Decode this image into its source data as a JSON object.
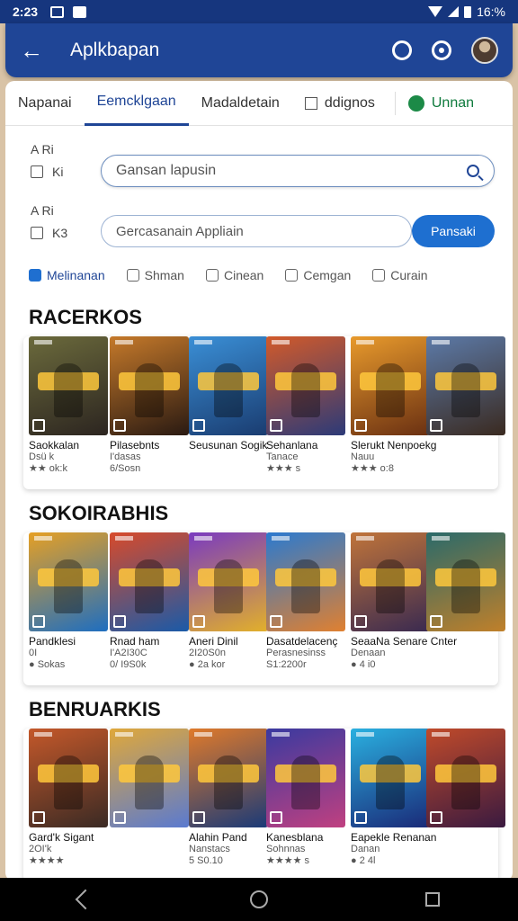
{
  "status": {
    "time": "2:23",
    "battery": "16:%"
  },
  "appbar": {
    "title": "Aplkbapan"
  },
  "tabs": [
    {
      "label": "Napanai"
    },
    {
      "label": "Eemcklgaan"
    },
    {
      "label": "Madaldetain"
    },
    {
      "label": "ddignos"
    },
    {
      "label": "Unnan"
    }
  ],
  "filters": {
    "label1": "A Ri",
    "check1": "Ki",
    "label2": "A Ri",
    "check2": "K3",
    "search_placeholder": "Gansan lapusin",
    "input_placeholder": "Gercasanain Appliain",
    "button": "Pansaki"
  },
  "chips": [
    "Melinanan",
    "Shman",
    "Cinean",
    "Cemgan",
    "Curain"
  ],
  "sections": [
    {
      "title": "RACERKOS",
      "games": [
        {
          "name": "Saokkalan",
          "sub": "Dsü k",
          "meta": "★★ ok:k",
          "colors": [
            "#6b6a3c",
            "#2c2520"
          ]
        },
        {
          "name": "Pilasebnts",
          "sub": "I'dasas",
          "meta": "6/Sosn",
          "colors": [
            "#c5792a",
            "#2a1a12"
          ]
        },
        {
          "name": "Seusunan Sogik",
          "sub": "",
          "meta": "",
          "colors": [
            "#3a8fd6",
            "#1a3c70"
          ]
        },
        {
          "name": "Sehanlana",
          "sub": "Tanace",
          "meta": "★★★ s",
          "colors": [
            "#d25a2a",
            "#2c3a78"
          ]
        },
        {
          "name": "Slerukt Nenpoekg",
          "sub": "Nauu",
          "meta": "★★★ o:8",
          "colors": [
            "#e89a2c",
            "#6a3012"
          ]
        },
        {
          "name": "",
          "sub": "",
          "meta": "",
          "colors": [
            "#5c7aa8",
            "#3a2a20"
          ]
        }
      ]
    },
    {
      "title": "SOKOIRABHIS",
      "games": [
        {
          "name": "Pandklesi",
          "sub": "0I",
          "meta": "● Sokas",
          "colors": [
            "#e6a024",
            "#1e6ec0"
          ]
        },
        {
          "name": "Rnad ham",
          "sub": "I'A2I30C",
          "meta": "0/ I9S0k",
          "colors": [
            "#d84a2a",
            "#1a5aa8"
          ]
        },
        {
          "name": "Aneri Dinil",
          "sub": "2I20S0n",
          "meta": "● 2a kor",
          "colors": [
            "#7a3ac0",
            "#e2b02a"
          ]
        },
        {
          "name": "Dasatdelacenç",
          "sub": "Perasnesinss",
          "meta": "S1:2200r",
          "colors": [
            "#2a7ad0",
            "#e08030"
          ]
        },
        {
          "name": "SeaaNa Senare Cnter",
          "sub": "Denaan",
          "meta": "● 4 i0",
          "colors": [
            "#c0743a",
            "#3a2a50"
          ]
        },
        {
          "name": "",
          "sub": "",
          "meta": "",
          "colors": [
            "#2a6a6a",
            "#c0802a"
          ]
        }
      ]
    },
    {
      "title": "BENRUARKIS",
      "games": [
        {
          "name": "Gard'k Sigant",
          "sub": "2OI'k",
          "meta": "★★★★",
          "colors": [
            "#c4582a",
            "#3a2a24"
          ]
        },
        {
          "name": "",
          "sub": "",
          "meta": "",
          "colors": [
            "#e0a83a",
            "#5a7ad0"
          ]
        },
        {
          "name": "Alahin Pand",
          "sub": "Nanstacs",
          "meta": "5 S0.10",
          "colors": [
            "#e07a2a",
            "#1a3a78"
          ]
        },
        {
          "name": "Kanesblana",
          "sub": "Sohnnas",
          "meta": "★★★★ s",
          "colors": [
            "#3a3aa0",
            "#c04080"
          ]
        },
        {
          "name": "Eapekle Renanan",
          "sub": "Danan",
          "meta": "● 2 4l",
          "colors": [
            "#2ab0e0",
            "#1a2a78"
          ]
        },
        {
          "name": "",
          "sub": "",
          "meta": "",
          "colors": [
            "#c04a2a",
            "#3a1a40"
          ]
        }
      ]
    }
  ]
}
